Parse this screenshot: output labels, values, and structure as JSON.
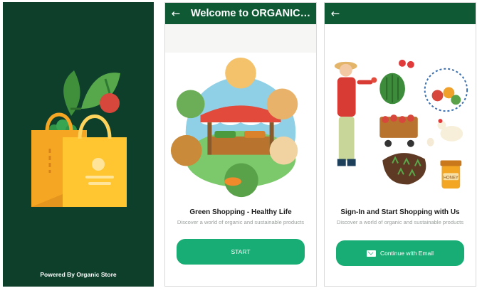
{
  "splash": {
    "footer": "Powered By Organic Store",
    "logo_icon": "shopping-bag-vegetables-icon",
    "background": "#0d3f2a"
  },
  "welcome": {
    "title": "Welcome to ORGANIC PL...",
    "back_icon": "arrow-left-icon",
    "heading": "Green Shopping - Healthy Life",
    "subtitle": "Discover a world of organic and sustainable products",
    "start_label": "START"
  },
  "signin": {
    "back_icon": "arrow-left-icon",
    "heading": "Sign-In and Start Shopping with Us",
    "subtitle": "Discover a world of organic and sustainable products",
    "email_button_label": "Continue with Email",
    "email_icon": "mail-icon",
    "honey_label": "HONEY"
  },
  "colors": {
    "appbar": "#0f5a35",
    "accent": "#18ad74",
    "splash_bg": "#0d3f2a"
  }
}
